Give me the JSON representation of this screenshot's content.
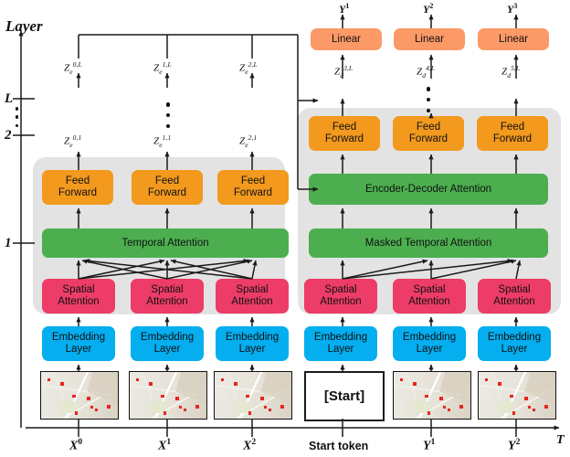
{
  "figure": {
    "layer_axis_title": "Layer",
    "layer_ticks": [
      "L",
      "2",
      "1"
    ],
    "time_axis_label": "T"
  },
  "encoder": {
    "outputs_top": [
      {
        "base": "Z",
        "sub": "e",
        "sup": "0,L"
      },
      {
        "base": "Z",
        "sub": "e",
        "sup": "1,L"
      },
      {
        "base": "Z",
        "sub": "e",
        "sup": "2,L"
      }
    ],
    "outputs_layer1": [
      {
        "base": "Z",
        "sub": "e",
        "sup": "0,1"
      },
      {
        "base": "Z",
        "sub": "e",
        "sup": "1,1"
      },
      {
        "base": "Z",
        "sub": "e",
        "sup": "2,1"
      }
    ],
    "feed_forward_label": [
      "Feed",
      "Forward"
    ],
    "temporal_attention_label": "Temporal Attention",
    "spatial_attention_label": [
      "Spatial",
      "Attention"
    ],
    "embedding_label": [
      "Embedding",
      "Layer"
    ],
    "inputs": [
      {
        "base": "X",
        "sup": "0"
      },
      {
        "base": "X",
        "sup": "1"
      },
      {
        "base": "X",
        "sup": "2"
      }
    ]
  },
  "decoder": {
    "predictions": [
      {
        "base": "Y",
        "sup": "1"
      },
      {
        "base": "Y",
        "sup": "2"
      },
      {
        "base": "Y",
        "sup": "3"
      }
    ],
    "linear_label": "Linear",
    "outputs_top": [
      {
        "base": "Z",
        "sub": "d",
        "sup": "3,L"
      },
      {
        "base": "Z",
        "sub": "d",
        "sup": "4,L"
      },
      {
        "base": "Z",
        "sub": "d",
        "sup": "5,L"
      }
    ],
    "feed_forward_label": [
      "Feed",
      "Forward"
    ],
    "encoder_decoder_attention_label": "Encoder-Decoder Attention",
    "masked_temporal_attention_label": "Masked Temporal Attention",
    "spatial_attention_label": [
      "Spatial",
      "Attention"
    ],
    "embedding_label": [
      "Embedding",
      "Layer"
    ],
    "start_token_box_label": "[Start]",
    "inputs": [
      {
        "base": "Start token",
        "sup": ""
      },
      {
        "base": "Y",
        "sup": "1"
      },
      {
        "base": "Y",
        "sup": "2"
      }
    ]
  },
  "colors": {
    "feed_forward": "#F2991E",
    "attention": "#4CAE4F",
    "spatial_attention": "#ED3C68",
    "embedding": "#04AEEF",
    "linear": "#FB9A67",
    "panel": "#e3e3e3",
    "map_marker": "#e8251f"
  }
}
